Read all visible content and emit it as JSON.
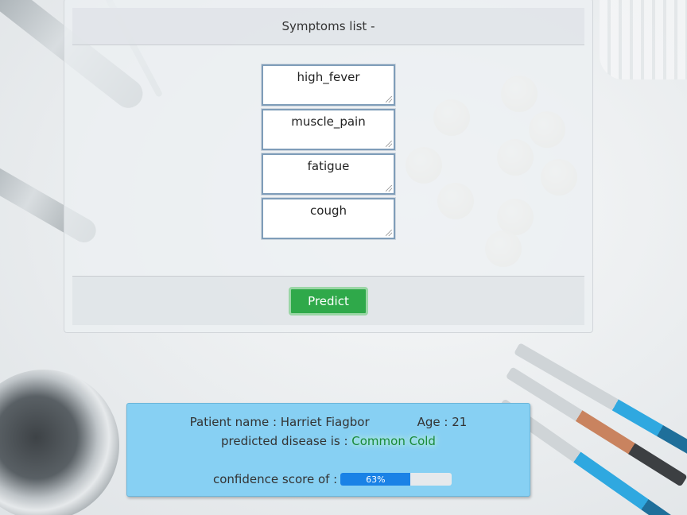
{
  "card": {
    "header": "Symptoms list -",
    "symptoms": [
      "high_fever",
      "muscle_pain",
      "fatigue",
      "cough"
    ],
    "predict_label": "Predict"
  },
  "result": {
    "patient_label": "Patient name : Harriet Fiagbor",
    "age_label": "Age : 21",
    "disease_prefix": "predicted disease is :",
    "disease": "Common Cold",
    "confidence_label": "confidence score of :",
    "confidence_percent": 63,
    "confidence_text": "63%"
  },
  "colors": {
    "predict_button": "#2fa94a",
    "result_panel": "#87d0f3",
    "progress_fill": "#1a82e6",
    "disease_text": "#1a8a3a"
  },
  "icons": {
    "resize_grip": "resize-grip-icon"
  }
}
